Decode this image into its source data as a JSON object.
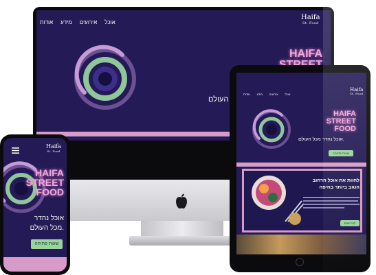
{
  "brand": {
    "logo_main": "Haifa",
    "logo_sub": "St. Food",
    "title_lines": [
      "HAIFA",
      "STREET",
      "FOOD"
    ]
  },
  "desktop": {
    "nav": [
      "אודות",
      "מידע",
      "אירועים",
      "אוכל"
    ],
    "tagline": "אוכל נהדר מכל העולם."
  },
  "tablet": {
    "nav": [
      "אודות",
      "מידע",
      "אירועים",
      "אוכל"
    ],
    "tagline": "אוכל נהדר מכל העולם.",
    "cta": "שעות פתיחה",
    "promo_lines": [
      "לחוות את אוכל הרחוב",
      "הטוב ביותר בחיפה"
    ],
    "promo_button": "לאירועים"
  },
  "phone": {
    "tagline_lines": [
      "אוכל נהדר",
      "מכל העולם."
    ],
    "cta": "שעות פתיחה"
  },
  "colors": {
    "screen_bg": "#241a56",
    "accent_pink": "#d79bc8",
    "button_green": "#9bd49b"
  }
}
